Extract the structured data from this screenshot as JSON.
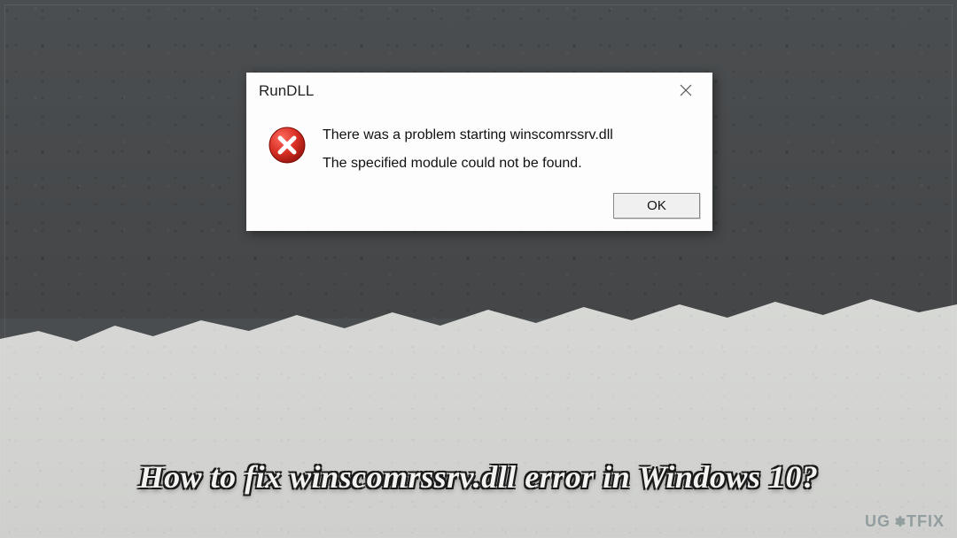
{
  "dialog": {
    "title": "RunDLL",
    "message_main": "There was a problem starting winscomrssrv.dll",
    "message_sub": "The specified module could not be found.",
    "ok_label": "OK"
  },
  "caption": "How to fix winscomrssrv.dll error in Windows 10?",
  "watermark": {
    "prefix": "UG",
    "suffix": "TFIX"
  },
  "colors": {
    "dialog_bg": "#fdfdfd",
    "error_red": "#d93025",
    "bg_dark": "#4a4d4f",
    "bg_light": "#d6d7d4"
  }
}
